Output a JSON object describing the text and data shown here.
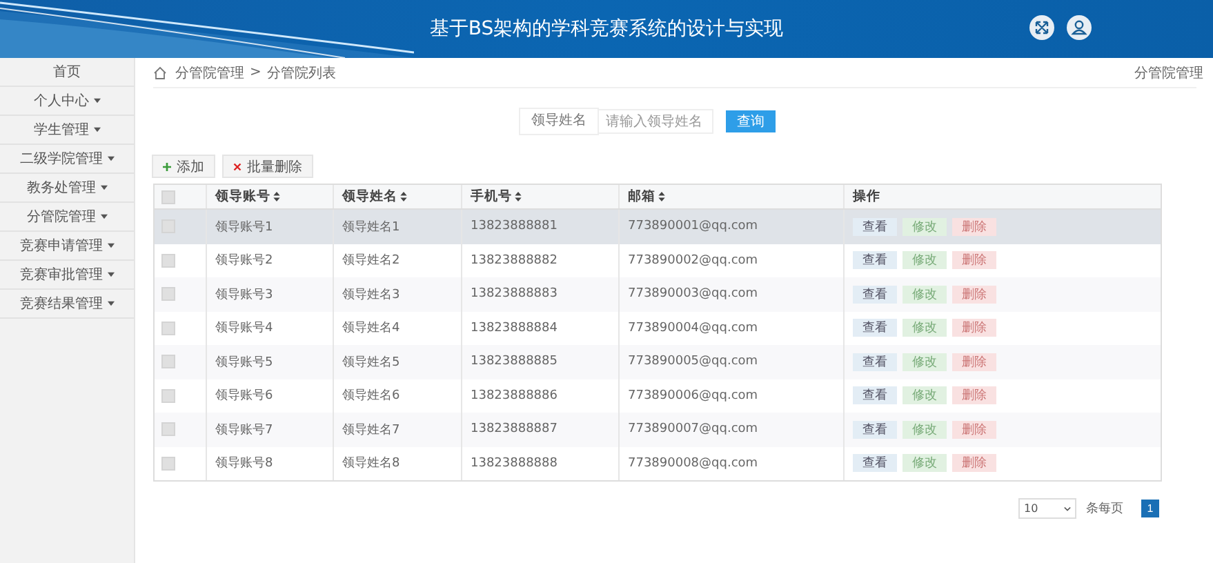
{
  "header": {
    "title": "基于BS架构的学科竞赛系统的设计与实现"
  },
  "sidebar": {
    "items": [
      {
        "label": "首页",
        "has_menu": false
      },
      {
        "label": "个人中心",
        "has_menu": true
      },
      {
        "label": "学生管理",
        "has_menu": true
      },
      {
        "label": "二级学院管理",
        "has_menu": true
      },
      {
        "label": "教务处管理",
        "has_menu": true
      },
      {
        "label": "分管院管理",
        "has_menu": true
      },
      {
        "label": "竞赛申请管理",
        "has_menu": true
      },
      {
        "label": "竞赛审批管理",
        "has_menu": true
      },
      {
        "label": "竞赛结果管理",
        "has_menu": true
      }
    ]
  },
  "breadcrumb": {
    "items": [
      "分管院管理",
      "分管院列表"
    ],
    "separator": ">",
    "page_title": "分管院管理"
  },
  "search": {
    "label": "领导姓名",
    "placeholder": "请输入领导姓名",
    "button": "查询"
  },
  "actions": {
    "add": "添加",
    "batch_delete": "批量删除"
  },
  "table": {
    "all_checked": false,
    "columns": [
      {
        "label": "领导账号",
        "sortable": true
      },
      {
        "label": "领导姓名",
        "sortable": true
      },
      {
        "label": "手机号",
        "sortable": true
      },
      {
        "label": "邮箱",
        "sortable": true
      },
      {
        "label": "操作",
        "sortable": false
      }
    ],
    "rows": [
      {
        "cells": [
          "领导账号1",
          "领导姓名1",
          "13823888881",
          "773890001@qq.com"
        ],
        "selected": true,
        "checked": false,
        "buttons": [
          {
            "label": "查看",
            "kind": "view"
          },
          {
            "label": "修改",
            "kind": "edit"
          },
          {
            "label": "删除",
            "kind": "delete"
          }
        ]
      },
      {
        "cells": [
          "领导账号2",
          "领导姓名2",
          "13823888882",
          "773890002@qq.com"
        ],
        "selected": false,
        "checked": false,
        "buttons": [
          {
            "label": "查看",
            "kind": "view"
          },
          {
            "label": "修改",
            "kind": "edit"
          },
          {
            "label": "删除",
            "kind": "delete"
          }
        ]
      },
      {
        "cells": [
          "领导账号3",
          "领导姓名3",
          "13823888883",
          "773890003@qq.com"
        ],
        "selected": false,
        "checked": false,
        "buttons": [
          {
            "label": "查看",
            "kind": "view"
          },
          {
            "label": "修改",
            "kind": "edit"
          },
          {
            "label": "删除",
            "kind": "delete"
          }
        ]
      },
      {
        "cells": [
          "领导账号4",
          "领导姓名4",
          "13823888884",
          "773890004@qq.com"
        ],
        "selected": false,
        "checked": false,
        "buttons": [
          {
            "label": "查看",
            "kind": "view"
          },
          {
            "label": "修改",
            "kind": "edit"
          },
          {
            "label": "删除",
            "kind": "delete"
          }
        ]
      },
      {
        "cells": [
          "领导账号5",
          "领导姓名5",
          "13823888885",
          "773890005@qq.com"
        ],
        "selected": false,
        "checked": false,
        "buttons": [
          {
            "label": "查看",
            "kind": "view"
          },
          {
            "label": "修改",
            "kind": "edit"
          },
          {
            "label": "删除",
            "kind": "delete"
          }
        ]
      },
      {
        "cells": [
          "领导账号6",
          "领导姓名6",
          "13823888886",
          "773890006@qq.com"
        ],
        "selected": false,
        "checked": false,
        "buttons": [
          {
            "label": "查看",
            "kind": "view"
          },
          {
            "label": "修改",
            "kind": "edit"
          },
          {
            "label": "删除",
            "kind": "delete"
          }
        ]
      },
      {
        "cells": [
          "领导账号7",
          "领导姓名7",
          "13823888887",
          "773890007@qq.com"
        ],
        "selected": false,
        "checked": false,
        "buttons": [
          {
            "label": "查看",
            "kind": "view"
          },
          {
            "label": "修改",
            "kind": "edit"
          },
          {
            "label": "删除",
            "kind": "delete"
          }
        ]
      },
      {
        "cells": [
          "领导账号8",
          "领导姓名8",
          "13823888888",
          "773890008@qq.com"
        ],
        "selected": false,
        "checked": false,
        "buttons": [
          {
            "label": "查看",
            "kind": "view"
          },
          {
            "label": "修改",
            "kind": "edit"
          },
          {
            "label": "删除",
            "kind": "delete"
          }
        ]
      }
    ]
  },
  "pagination": {
    "page_size": "10",
    "page_size_label": "条每页",
    "pages": [
      {
        "label": "1",
        "selected": true
      }
    ]
  }
}
